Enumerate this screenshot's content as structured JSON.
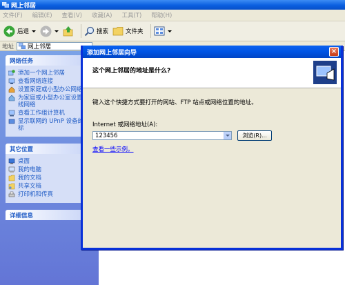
{
  "window": {
    "title": "网上邻居"
  },
  "menu": [
    "文件(F)",
    "编辑(E)",
    "查看(V)",
    "收藏(A)",
    "工具(T)",
    "帮助(H)"
  ],
  "toolbar": {
    "back_label": "后退",
    "search_label": "搜索",
    "folders_label": "文件夹"
  },
  "address": {
    "label": "地址",
    "value": "网上邻居"
  },
  "left_pane": {
    "network_tasks": {
      "title": "网络任务",
      "items": [
        "添加一个网上邻居",
        "查看网络连接",
        "设置家庭或小型办公网络",
        "为家庭或小型办公室设置无线网络",
        "查看工作组计算机",
        "显示联网的 UPnP 设备的图标"
      ]
    },
    "other_places": {
      "title": "其它位置",
      "items": [
        "桌面",
        "我的电脑",
        "我的文档",
        "共享文档",
        "打印机和传真"
      ]
    },
    "details": {
      "title": "详细信息"
    }
  },
  "wizard": {
    "title": "添加网上邻居向导",
    "heading": "这个网上邻居的地址是什么?",
    "instruction": "键入这个快捷方式要打开的网站、FTP 站点或网络位置的地址。",
    "field_label": "Internet 或网络地址(A):",
    "field_value": "123456",
    "browse_label": "浏览(R)...",
    "example_link": "查看一些示例。"
  }
}
